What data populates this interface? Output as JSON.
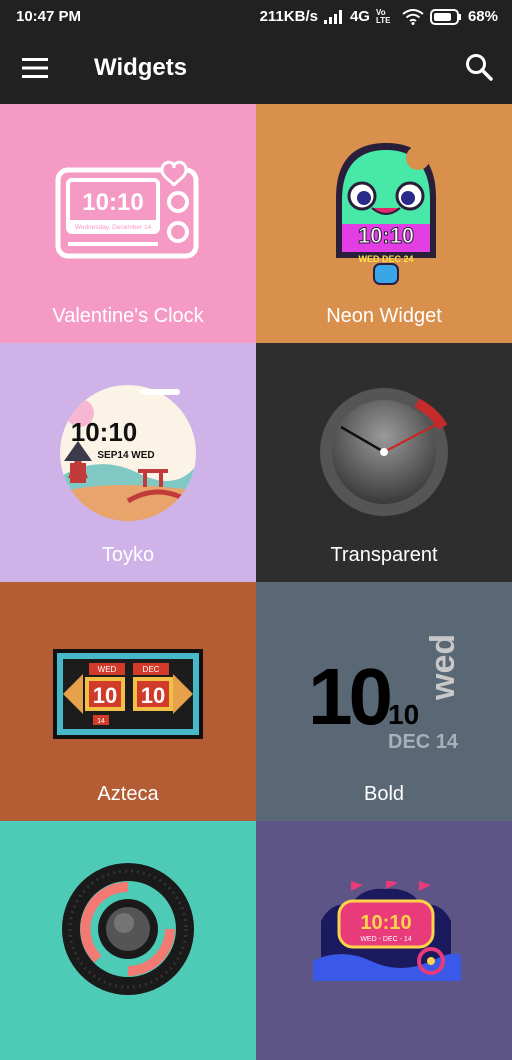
{
  "status_bar": {
    "time": "10:47 PM",
    "network_speed": "211KB/s",
    "network_type": "4G",
    "volte": "Vo LTE",
    "battery": "68%"
  },
  "app_bar": {
    "title": "Widgets",
    "menu_icon": "hamburger-menu-icon",
    "search_icon": "search-icon"
  },
  "widgets": [
    {
      "name": "Valentine's Clock",
      "bg": "#f49ac5",
      "preview": {
        "time": "10:10",
        "date": "Wednesday, December 14"
      }
    },
    {
      "name": "Neon Widget",
      "bg": "#d9904d",
      "preview": {
        "time": "10:10",
        "date": "WED DEC 24"
      }
    },
    {
      "name": "Toyko",
      "bg": "#cfb3e8",
      "preview": {
        "time": "10:10",
        "date": "SEP14  WED"
      }
    },
    {
      "name": "Transparent",
      "bg": "#2e2e2e",
      "preview": {}
    },
    {
      "name": "Azteca",
      "bg": "#b45d35",
      "preview": {
        "left_label": "WED",
        "right_label": "DEC",
        "hour": "10",
        "minute": "10",
        "day": "14"
      }
    },
    {
      "name": "Bold",
      "bg": "#5a6775",
      "preview": {
        "hour": "10",
        "minute": "10",
        "weekday": "wed",
        "date": "DEC 14"
      }
    },
    {
      "name": "",
      "bg": "#4ecbb6",
      "preview": {}
    },
    {
      "name": "",
      "bg": "#5e5587",
      "preview": {
        "time": "10:10",
        "date": "WED - DEC - 14"
      }
    }
  ]
}
